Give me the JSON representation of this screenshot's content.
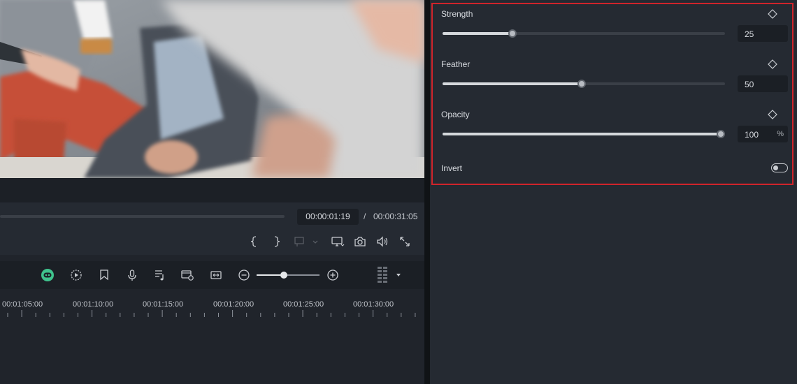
{
  "player": {
    "current_time": "00:00:01:19",
    "separator": "/",
    "total_time": "00:00:31:05",
    "progress_fraction": 0.0,
    "controls": [
      "mark-in-icon",
      "mark-out-icon",
      "snapshot-disabled-icon",
      "display-monitor-icon",
      "camera-icon",
      "volume-icon",
      "fullscreen-icon"
    ]
  },
  "toolbar": {
    "icons": [
      "ai-copilot-icon",
      "auto-play-icon",
      "marker-icon",
      "microphone-icon",
      "audio-list-icon",
      "speech-preview-icon",
      "replace-icon",
      "zoom-out-icon",
      "zoom-in-icon",
      "track-layout-icon",
      "dropdown-icon"
    ],
    "zoom_level_fraction": 0.43
  },
  "ruler": {
    "labels": [
      "00:01:05:00",
      "00:01:10:00",
      "00:01:15:00",
      "00:01:20:00",
      "00:01:25:00",
      "00:01:30:00"
    ]
  },
  "properties": {
    "strength": {
      "label": "Strength",
      "value": "25",
      "fraction": 0.25
    },
    "feather": {
      "label": "Feather",
      "value": "50",
      "fraction": 0.5
    },
    "opacity": {
      "label": "Opacity",
      "value": "100",
      "unit": "%",
      "fraction": 1.0
    },
    "invert": {
      "label": "Invert",
      "enabled": false
    }
  },
  "colors": {
    "highlight_border": "#d0242b",
    "panel_bg": "#252a32",
    "timeline_bg": "#20242b"
  }
}
